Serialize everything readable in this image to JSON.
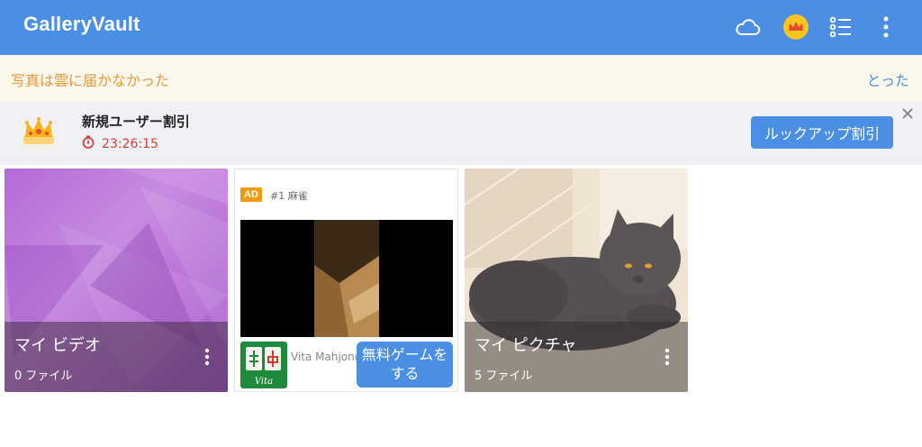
{
  "app": {
    "title": "GalleryVault",
    "icons": [
      "cloud-icon",
      "crown-icon",
      "list-icon",
      "more-vert-icon"
    ],
    "colors": {
      "primary": "#4a8fe3",
      "warning_text": "#e7983a",
      "timer": "#d6403a",
      "ad_badge": "#f29a0e"
    }
  },
  "notice": {
    "text": "写真は雲に届かなかった",
    "action": "とった"
  },
  "promo": {
    "title": "新規ユーザー割引",
    "timer": "23:26:15",
    "button": "ルックアップ割引"
  },
  "cards": [
    {
      "title": "マイ ビデオ",
      "subtitle": "0 ファイル"
    },
    {
      "title": "マイ ピクチャ",
      "subtitle": "5 ファイル"
    }
  ],
  "ad": {
    "badge": "AD",
    "label": "#1 麻雀",
    "app_name": "Vita Mahjong",
    "app_icon_text": "Vita",
    "cta": "無料ゲームをする"
  }
}
